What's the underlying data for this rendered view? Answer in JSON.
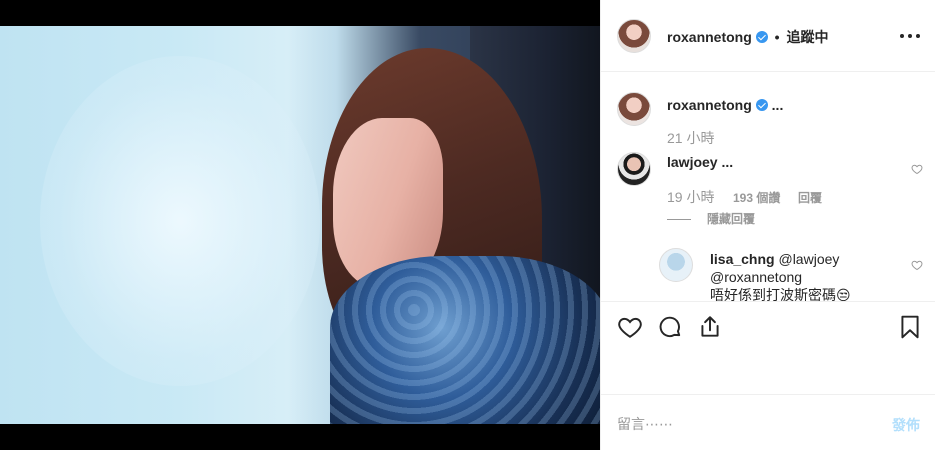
{
  "post": {
    "photo_alt_icon": "photo",
    "colors": {
      "verified": "#3897f0",
      "meta": "#999999",
      "post_disabled": "#b2dffc"
    }
  },
  "header": {
    "username": "roxannetong",
    "separator": "•",
    "follow_status": "追蹤中",
    "more_icon": "more-horizontal-icon"
  },
  "comments": [
    {
      "username": "roxannetong",
      "text": "...",
      "time": "21 小時"
    },
    {
      "username": "lawjoey",
      "text": "...",
      "time": "19 小時",
      "likes": "193 個讚",
      "reply": "回覆",
      "hide_replies": "隱藏回覆"
    },
    {
      "username": "lisa_chng",
      "mention1": "@lawjoey",
      "mention2": "@roxannetong",
      "text": "唔好係到打波斯密碼😒"
    }
  ],
  "actions": {
    "like_icon": "heart-icon",
    "comment_icon": "comment-icon",
    "share_icon": "share-icon",
    "save_icon": "bookmark-icon"
  },
  "composer": {
    "placeholder": "留言⋯⋯",
    "post_label": "發佈"
  }
}
